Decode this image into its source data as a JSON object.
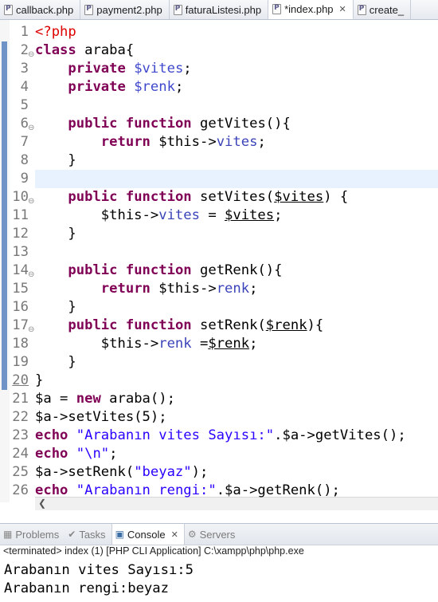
{
  "editor_tabs": [
    {
      "label": "callback.php",
      "active": false
    },
    {
      "label": "payment2.php",
      "active": false
    },
    {
      "label": "faturaListesi.php",
      "active": false
    },
    {
      "label": "*index.php",
      "active": true
    },
    {
      "label": "create_",
      "active": false
    }
  ],
  "code_lines": [
    {
      "n": "1",
      "tokens": [
        {
          "t": "<?php",
          "c": "php"
        }
      ]
    },
    {
      "n": "2",
      "fold": true,
      "tokens": [
        {
          "t": "class",
          "c": "kw"
        },
        {
          "t": " araba{",
          "c": ""
        }
      ]
    },
    {
      "n": "3",
      "tokens": [
        {
          "t": "    ",
          "c": ""
        },
        {
          "t": "private",
          "c": "kw"
        },
        {
          "t": " ",
          "c": ""
        },
        {
          "t": "$vites",
          "c": "var"
        },
        {
          "t": ";",
          "c": ""
        }
      ]
    },
    {
      "n": "4",
      "tokens": [
        {
          "t": "    ",
          "c": ""
        },
        {
          "t": "private",
          "c": "kw"
        },
        {
          "t": " ",
          "c": ""
        },
        {
          "t": "$renk",
          "c": "var"
        },
        {
          "t": ";",
          "c": ""
        }
      ]
    },
    {
      "n": "5",
      "tokens": []
    },
    {
      "n": "6",
      "fold": true,
      "tokens": [
        {
          "t": "    ",
          "c": ""
        },
        {
          "t": "public",
          "c": "kw"
        },
        {
          "t": " ",
          "c": ""
        },
        {
          "t": "function",
          "c": "kw"
        },
        {
          "t": " getVites(){",
          "c": ""
        }
      ]
    },
    {
      "n": "7",
      "tokens": [
        {
          "t": "        ",
          "c": ""
        },
        {
          "t": "return",
          "c": "kw"
        },
        {
          "t": " $this->",
          "c": ""
        },
        {
          "t": "vites",
          "c": "fld"
        },
        {
          "t": ";",
          "c": ""
        }
      ]
    },
    {
      "n": "8",
      "tokens": [
        {
          "t": "    }",
          "c": ""
        }
      ]
    },
    {
      "n": "9",
      "highlight": true,
      "tokens": []
    },
    {
      "n": "10",
      "fold": true,
      "tokens": [
        {
          "t": "    ",
          "c": ""
        },
        {
          "t": "public",
          "c": "kw"
        },
        {
          "t": " ",
          "c": ""
        },
        {
          "t": "function",
          "c": "kw"
        },
        {
          "t": " setVites(",
          "c": ""
        },
        {
          "t": "$vites",
          "c": "prm"
        },
        {
          "t": ") {",
          "c": ""
        }
      ]
    },
    {
      "n": "11",
      "tokens": [
        {
          "t": "        $this->",
          "c": ""
        },
        {
          "t": "vites",
          "c": "fld"
        },
        {
          "t": " = ",
          "c": ""
        },
        {
          "t": "$vites",
          "c": "prm"
        },
        {
          "t": ";",
          "c": ""
        }
      ]
    },
    {
      "n": "12",
      "tokens": [
        {
          "t": "    }",
          "c": ""
        }
      ]
    },
    {
      "n": "13",
      "tokens": []
    },
    {
      "n": "14",
      "fold": true,
      "tokens": [
        {
          "t": "    ",
          "c": ""
        },
        {
          "t": "public",
          "c": "kw"
        },
        {
          "t": " ",
          "c": ""
        },
        {
          "t": "function",
          "c": "kw"
        },
        {
          "t": " getRenk(){",
          "c": ""
        }
      ]
    },
    {
      "n": "15",
      "tokens": [
        {
          "t": "        ",
          "c": ""
        },
        {
          "t": "return",
          "c": "kw"
        },
        {
          "t": " $this->",
          "c": ""
        },
        {
          "t": "renk",
          "c": "fld"
        },
        {
          "t": ";",
          "c": ""
        }
      ]
    },
    {
      "n": "16",
      "tokens": [
        {
          "t": "    }",
          "c": ""
        }
      ]
    },
    {
      "n": "17",
      "fold": true,
      "tokens": [
        {
          "t": "    ",
          "c": ""
        },
        {
          "t": "public",
          "c": "kw"
        },
        {
          "t": " ",
          "c": ""
        },
        {
          "t": "function",
          "c": "kw"
        },
        {
          "t": " setRenk(",
          "c": ""
        },
        {
          "t": "$renk",
          "c": "prm"
        },
        {
          "t": "){",
          "c": ""
        }
      ]
    },
    {
      "n": "18",
      "tokens": [
        {
          "t": "        $this->",
          "c": ""
        },
        {
          "t": "renk",
          "c": "fld"
        },
        {
          "t": " =",
          "c": ""
        },
        {
          "t": "$renk",
          "c": "prm"
        },
        {
          "t": ";",
          "c": ""
        }
      ]
    },
    {
      "n": "19",
      "tokens": [
        {
          "t": "    }",
          "c": ""
        }
      ]
    },
    {
      "n": "20",
      "current": true,
      "tokens": [
        {
          "t": "}",
          "c": ""
        }
      ]
    },
    {
      "n": "21",
      "tokens": [
        {
          "t": "$a = ",
          "c": ""
        },
        {
          "t": "new",
          "c": "kw"
        },
        {
          "t": " araba();",
          "c": ""
        }
      ]
    },
    {
      "n": "22",
      "tokens": [
        {
          "t": "$a->setVites(5);",
          "c": ""
        }
      ]
    },
    {
      "n": "23",
      "tokens": [
        {
          "t": "echo",
          "c": "kw"
        },
        {
          "t": " ",
          "c": ""
        },
        {
          "t": "\"Arabanın vites Sayısı:\"",
          "c": "str"
        },
        {
          "t": ".$a->getVites();",
          "c": ""
        }
      ]
    },
    {
      "n": "24",
      "tokens": [
        {
          "t": "echo",
          "c": "kw"
        },
        {
          "t": " ",
          "c": ""
        },
        {
          "t": "\"\\n\"",
          "c": "str"
        },
        {
          "t": ";",
          "c": ""
        }
      ]
    },
    {
      "n": "25",
      "tokens": [
        {
          "t": "$a->setRenk(",
          "c": ""
        },
        {
          "t": "\"beyaz\"",
          "c": "str"
        },
        {
          "t": ");",
          "c": ""
        }
      ]
    },
    {
      "n": "26",
      "tokens": [
        {
          "t": "echo",
          "c": "kw"
        },
        {
          "t": " ",
          "c": ""
        },
        {
          "t": "\"Arabanın rengi:\"",
          "c": "str"
        },
        {
          "t": ".$a->getRenk();",
          "c": ""
        }
      ]
    }
  ],
  "bottom_panel": {
    "tabs": [
      {
        "label": "Problems",
        "icon": "problems-icon",
        "active": false
      },
      {
        "label": "Tasks",
        "icon": "tasks-icon",
        "active": false
      },
      {
        "label": "Console",
        "icon": "console-icon",
        "active": true
      },
      {
        "label": "Servers",
        "icon": "servers-icon",
        "active": false
      }
    ],
    "status": "<terminated> index (1) [PHP CLI Application] C:\\xampp\\php\\php.exe",
    "output": [
      "Arabanın vites Sayısı:5",
      "Arabanın rengi:beyaz"
    ]
  },
  "colors": {
    "keyword": "#7f0055",
    "variable": "#3f48cc",
    "string": "#2a00ff",
    "php_tag": "#dd0000",
    "current_line": "#e8f2fe",
    "range_marker": "#6f93c6"
  }
}
